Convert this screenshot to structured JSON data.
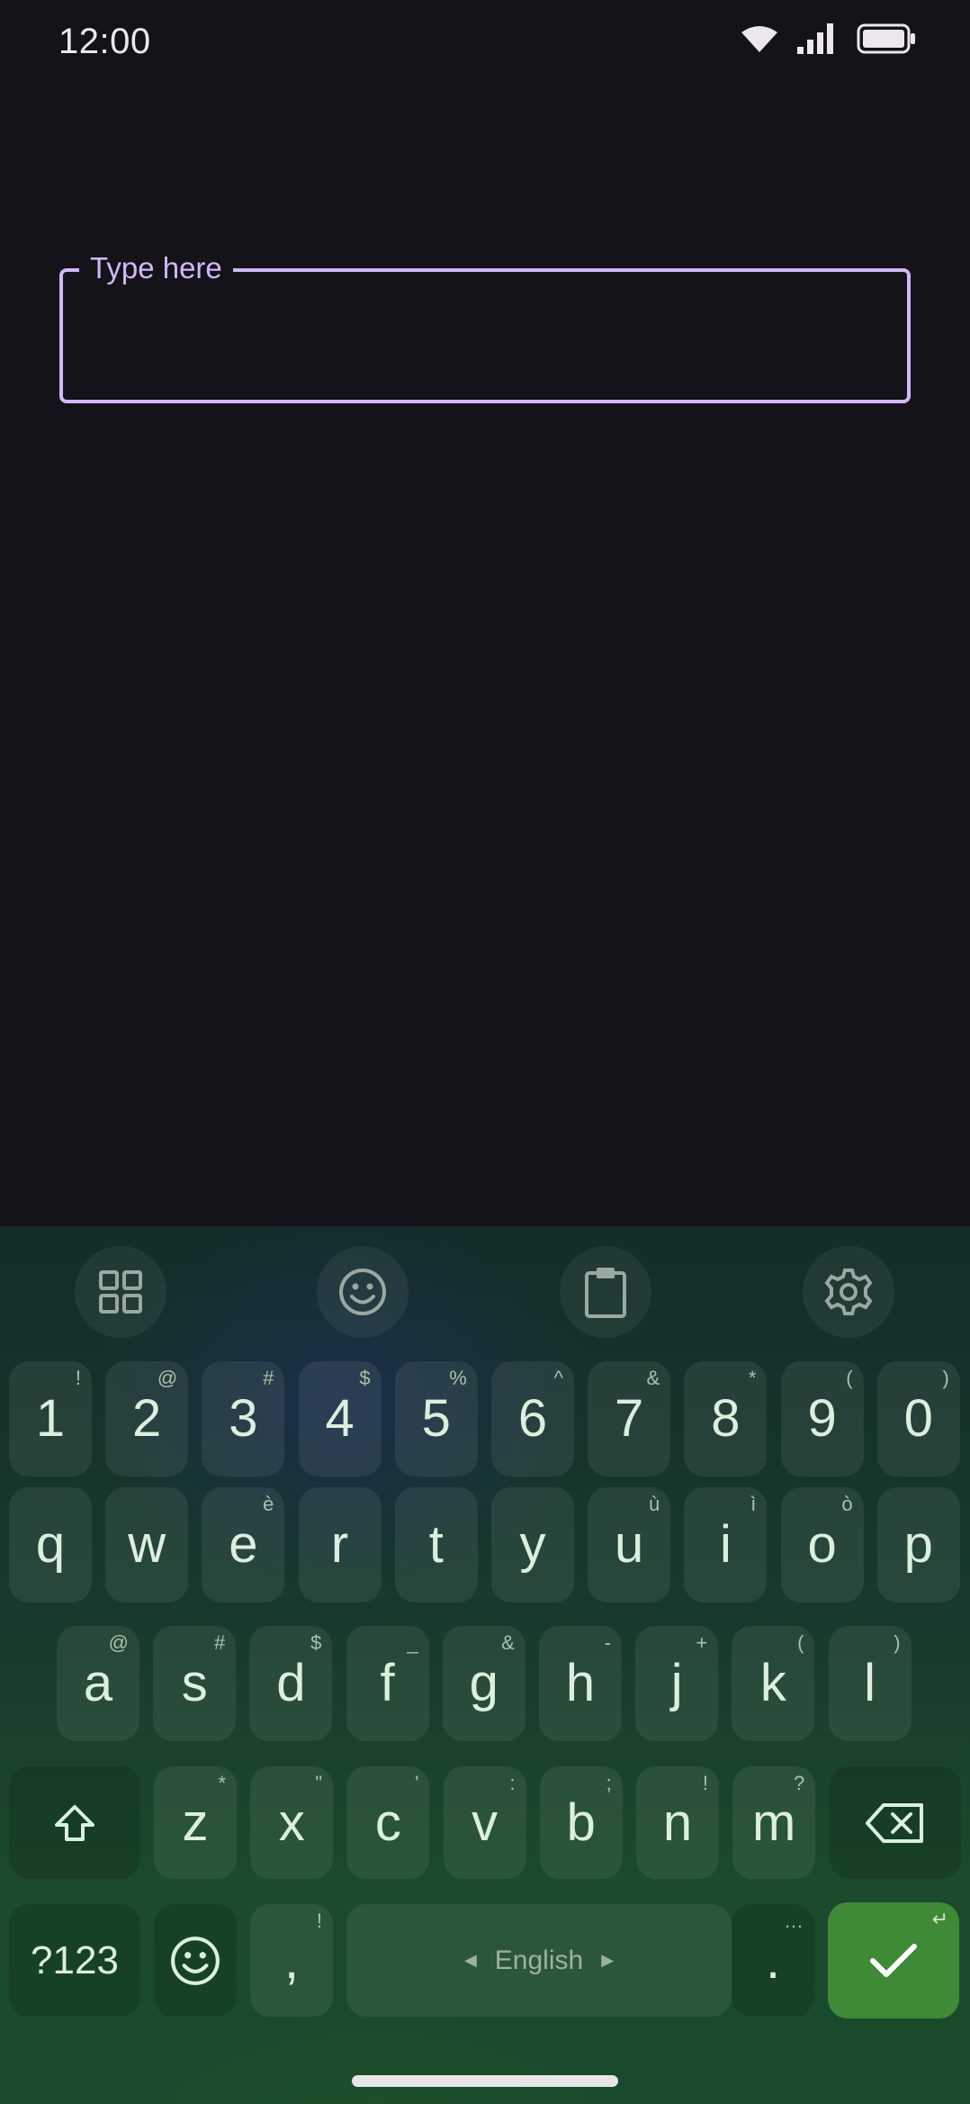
{
  "status": {
    "time": "12:00"
  },
  "text_field": {
    "label": "Type here",
    "value": ""
  },
  "keyboard": {
    "language": "English",
    "row_numbers": [
      {
        "key": "1",
        "hint": "!"
      },
      {
        "key": "2",
        "hint": "@"
      },
      {
        "key": "3",
        "hint": "#"
      },
      {
        "key": "4",
        "hint": "$"
      },
      {
        "key": "5",
        "hint": "%"
      },
      {
        "key": "6",
        "hint": "^"
      },
      {
        "key": "7",
        "hint": "&"
      },
      {
        "key": "8",
        "hint": "*"
      },
      {
        "key": "9",
        "hint": "("
      },
      {
        "key": "0",
        "hint": ")"
      }
    ],
    "row_1": [
      {
        "key": "q",
        "hint": ""
      },
      {
        "key": "w",
        "hint": ""
      },
      {
        "key": "e",
        "hint": "è"
      },
      {
        "key": "r",
        "hint": ""
      },
      {
        "key": "t",
        "hint": ""
      },
      {
        "key": "y",
        "hint": ""
      },
      {
        "key": "u",
        "hint": "ù"
      },
      {
        "key": "i",
        "hint": "ì"
      },
      {
        "key": "o",
        "hint": "ò"
      },
      {
        "key": "p",
        "hint": ""
      }
    ],
    "row_2": [
      {
        "key": "a",
        "hint": "@"
      },
      {
        "key": "s",
        "hint": "#"
      },
      {
        "key": "d",
        "hint": "$"
      },
      {
        "key": "f",
        "hint": "_"
      },
      {
        "key": "g",
        "hint": "&"
      },
      {
        "key": "h",
        "hint": "-"
      },
      {
        "key": "j",
        "hint": "+"
      },
      {
        "key": "k",
        "hint": "("
      },
      {
        "key": "l",
        "hint": ")"
      }
    ],
    "row_3": [
      {
        "key": "z",
        "hint": "*"
      },
      {
        "key": "x",
        "hint": "\""
      },
      {
        "key": "c",
        "hint": "'"
      },
      {
        "key": "v",
        "hint": ":"
      },
      {
        "key": "b",
        "hint": ";"
      },
      {
        "key": "n",
        "hint": "!"
      },
      {
        "key": "m",
        "hint": "?"
      }
    ],
    "bottom": {
      "symbols_label": "?123",
      "comma": ",",
      "comma_hint": "!",
      "period": ".",
      "period_hint": "…",
      "enter_hint": "↵"
    }
  },
  "colors": {
    "accent": "#cfb9f7",
    "enter": "#3f8a37",
    "background": "#15131a"
  }
}
